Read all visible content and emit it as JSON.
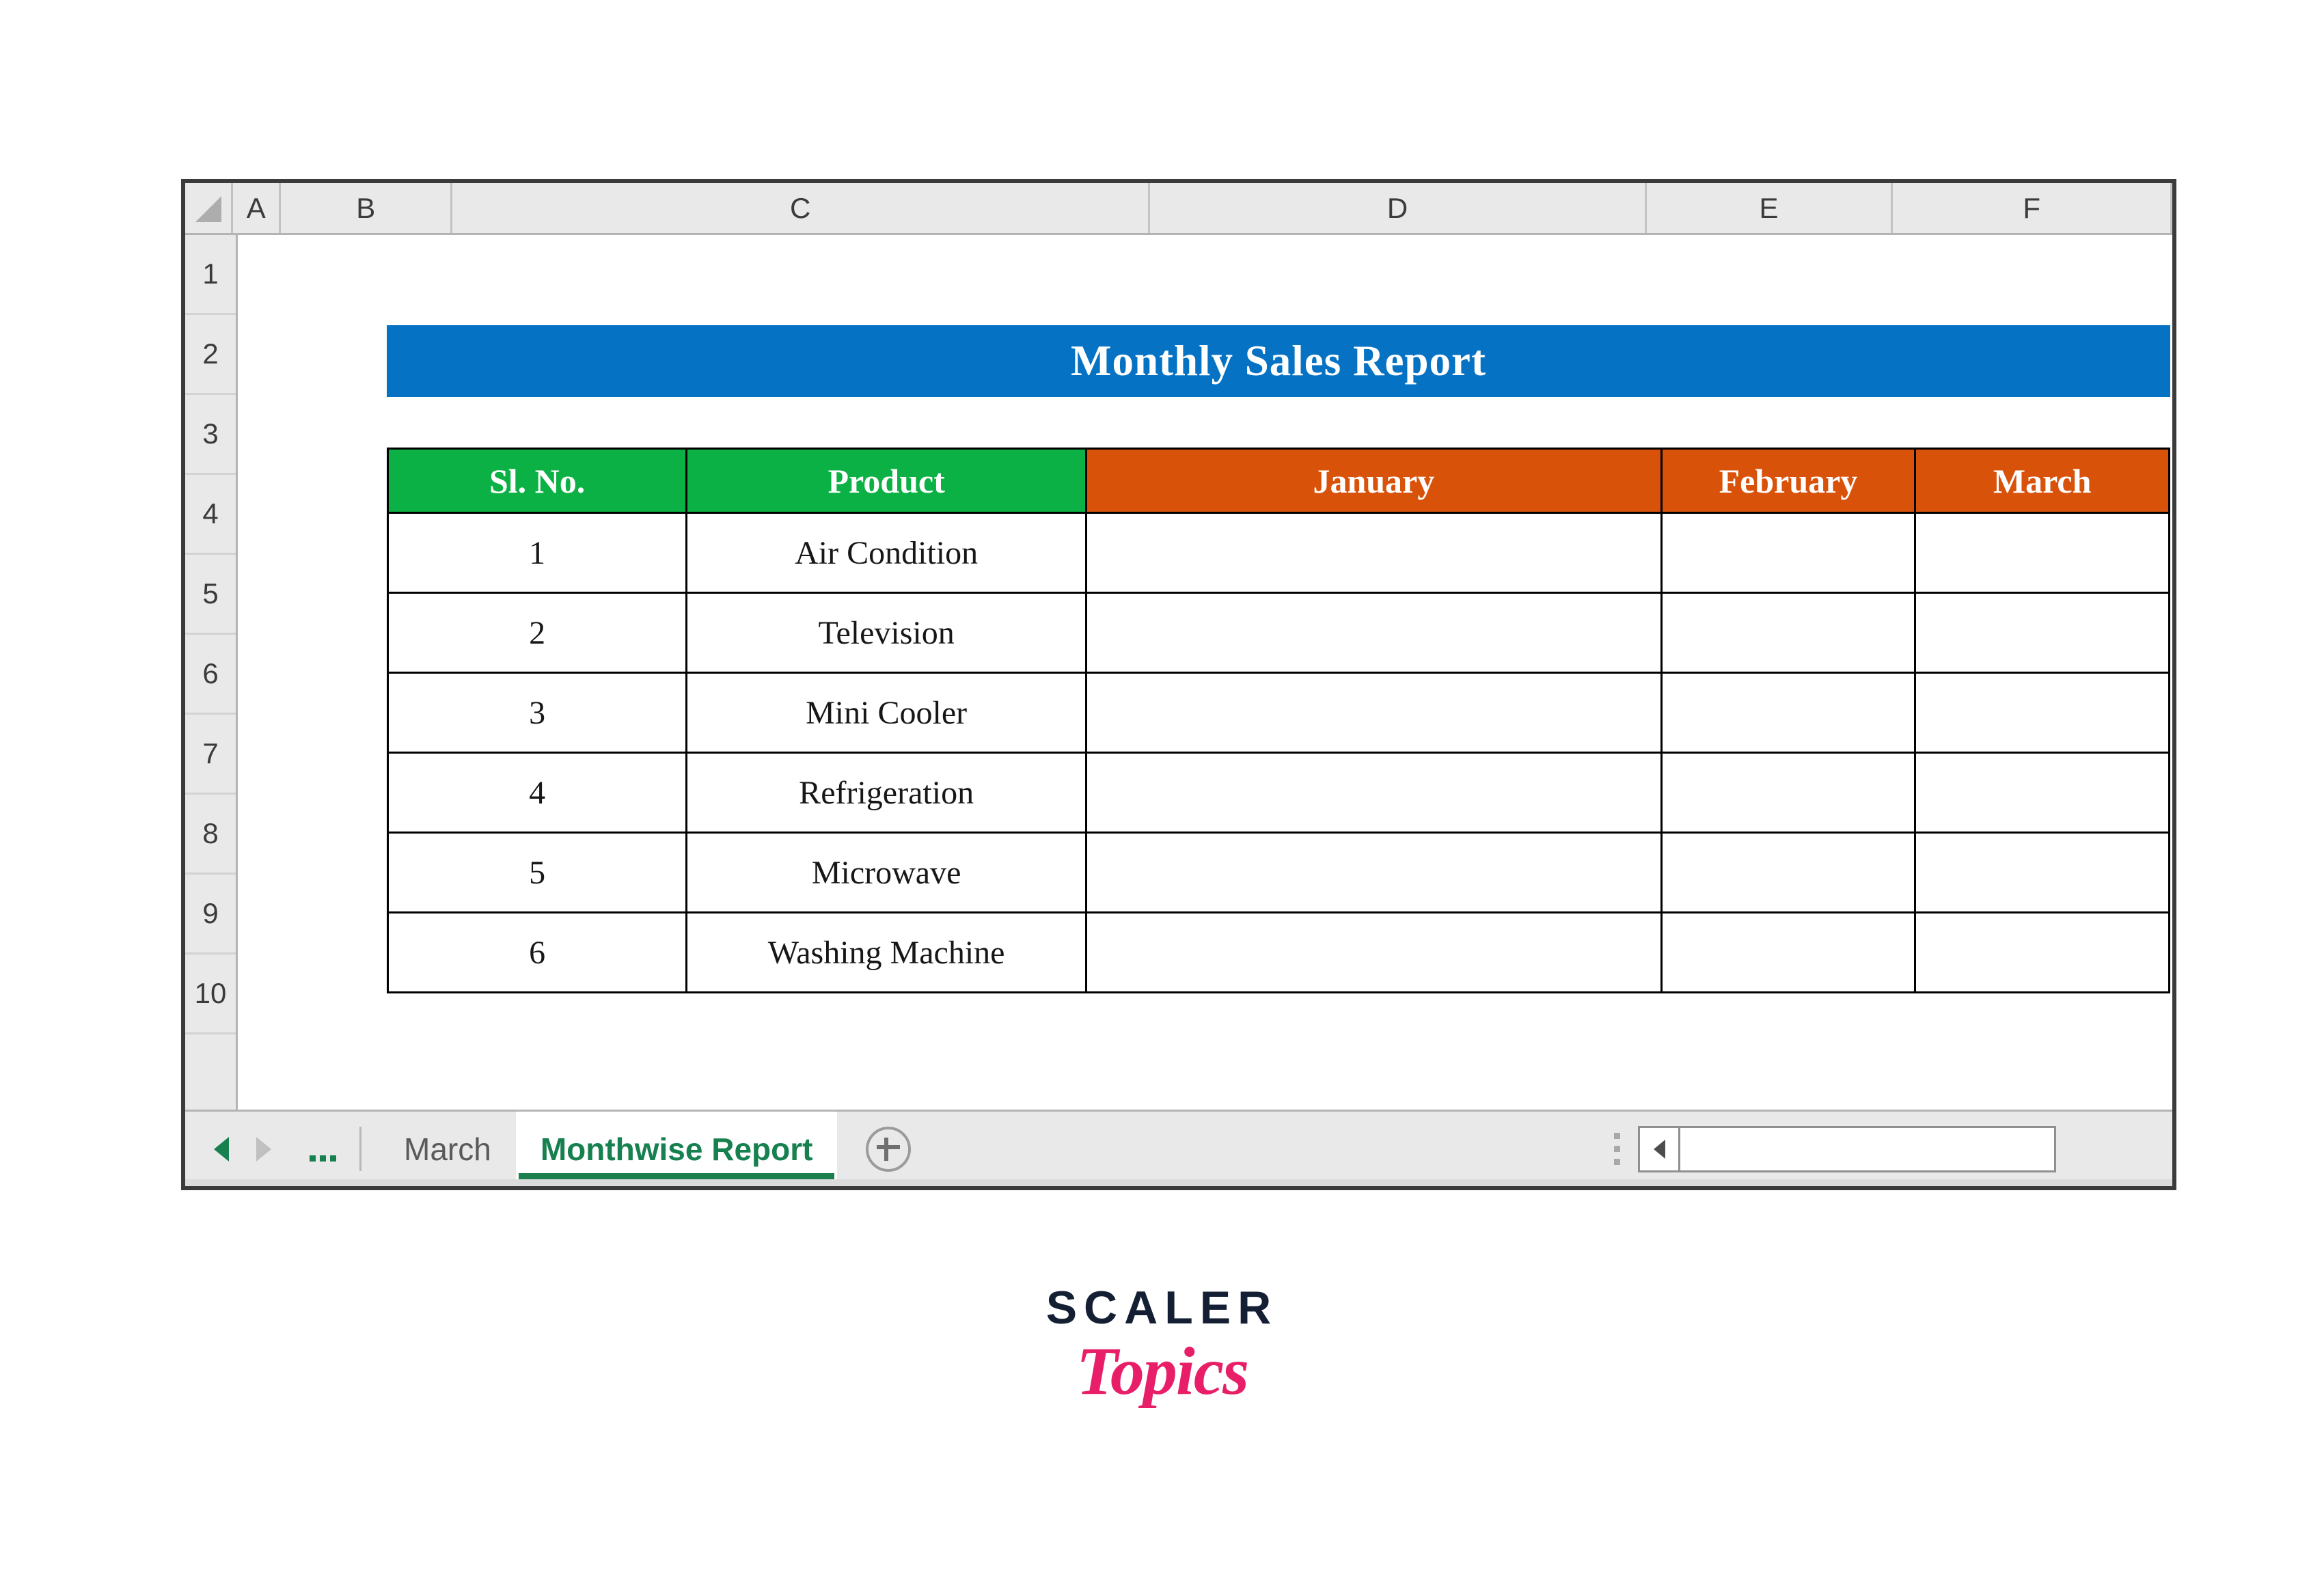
{
  "spreadsheet": {
    "column_headers": [
      "A",
      "B",
      "C",
      "D",
      "E",
      "F"
    ],
    "row_headers": [
      "1",
      "2",
      "3",
      "4",
      "5",
      "6",
      "7",
      "8",
      "9",
      "10"
    ],
    "select_all_icon": "select-all-triangle-icon"
  },
  "report": {
    "title": "Monthly Sales Report",
    "title_bg_color": "#0572C4",
    "title_text_color": "#FFFFFF"
  },
  "table": {
    "headers": [
      {
        "label": "Sl. No.",
        "bg_color": "#0BB144"
      },
      {
        "label": "Product",
        "bg_color": "#0BB144"
      },
      {
        "label": "January",
        "bg_color": "#D9520A"
      },
      {
        "label": "February",
        "bg_color": "#D9520A"
      },
      {
        "label": "March",
        "bg_color": "#D9520A"
      }
    ],
    "rows": [
      {
        "sl_no": "1",
        "product": "Air Condition",
        "january": "",
        "february": "",
        "march": ""
      },
      {
        "sl_no": "2",
        "product": "Television",
        "january": "",
        "february": "",
        "march": ""
      },
      {
        "sl_no": "3",
        "product": "Mini Cooler",
        "january": "",
        "february": "",
        "march": ""
      },
      {
        "sl_no": "4",
        "product": "Refrigeration",
        "january": "",
        "february": "",
        "march": ""
      },
      {
        "sl_no": "5",
        "product": "Microwave",
        "january": "",
        "february": "",
        "march": ""
      },
      {
        "sl_no": "6",
        "product": "Washing Machine",
        "january": "",
        "february": "",
        "march": ""
      }
    ]
  },
  "sheet_tabs": {
    "prev_icon": "nav-prev-arrow-icon",
    "next_icon": "nav-next-arrow-icon",
    "ellipsis_icon": "tab-ellipsis-icon",
    "tabs": [
      {
        "label": "March",
        "active": false
      },
      {
        "label": "Monthwise Report",
        "active": true
      }
    ],
    "add_sheet_icon": "add-sheet-plus-icon",
    "split_handle_icon": "split-handle-icon",
    "scroll_left_icon": "scroll-left-arrow-icon",
    "active_tab_color": "#16804F"
  },
  "logo": {
    "primary": "SCALER",
    "secondary": "Topics",
    "primary_color": "#141F33",
    "secondary_color": "#E81F68"
  }
}
